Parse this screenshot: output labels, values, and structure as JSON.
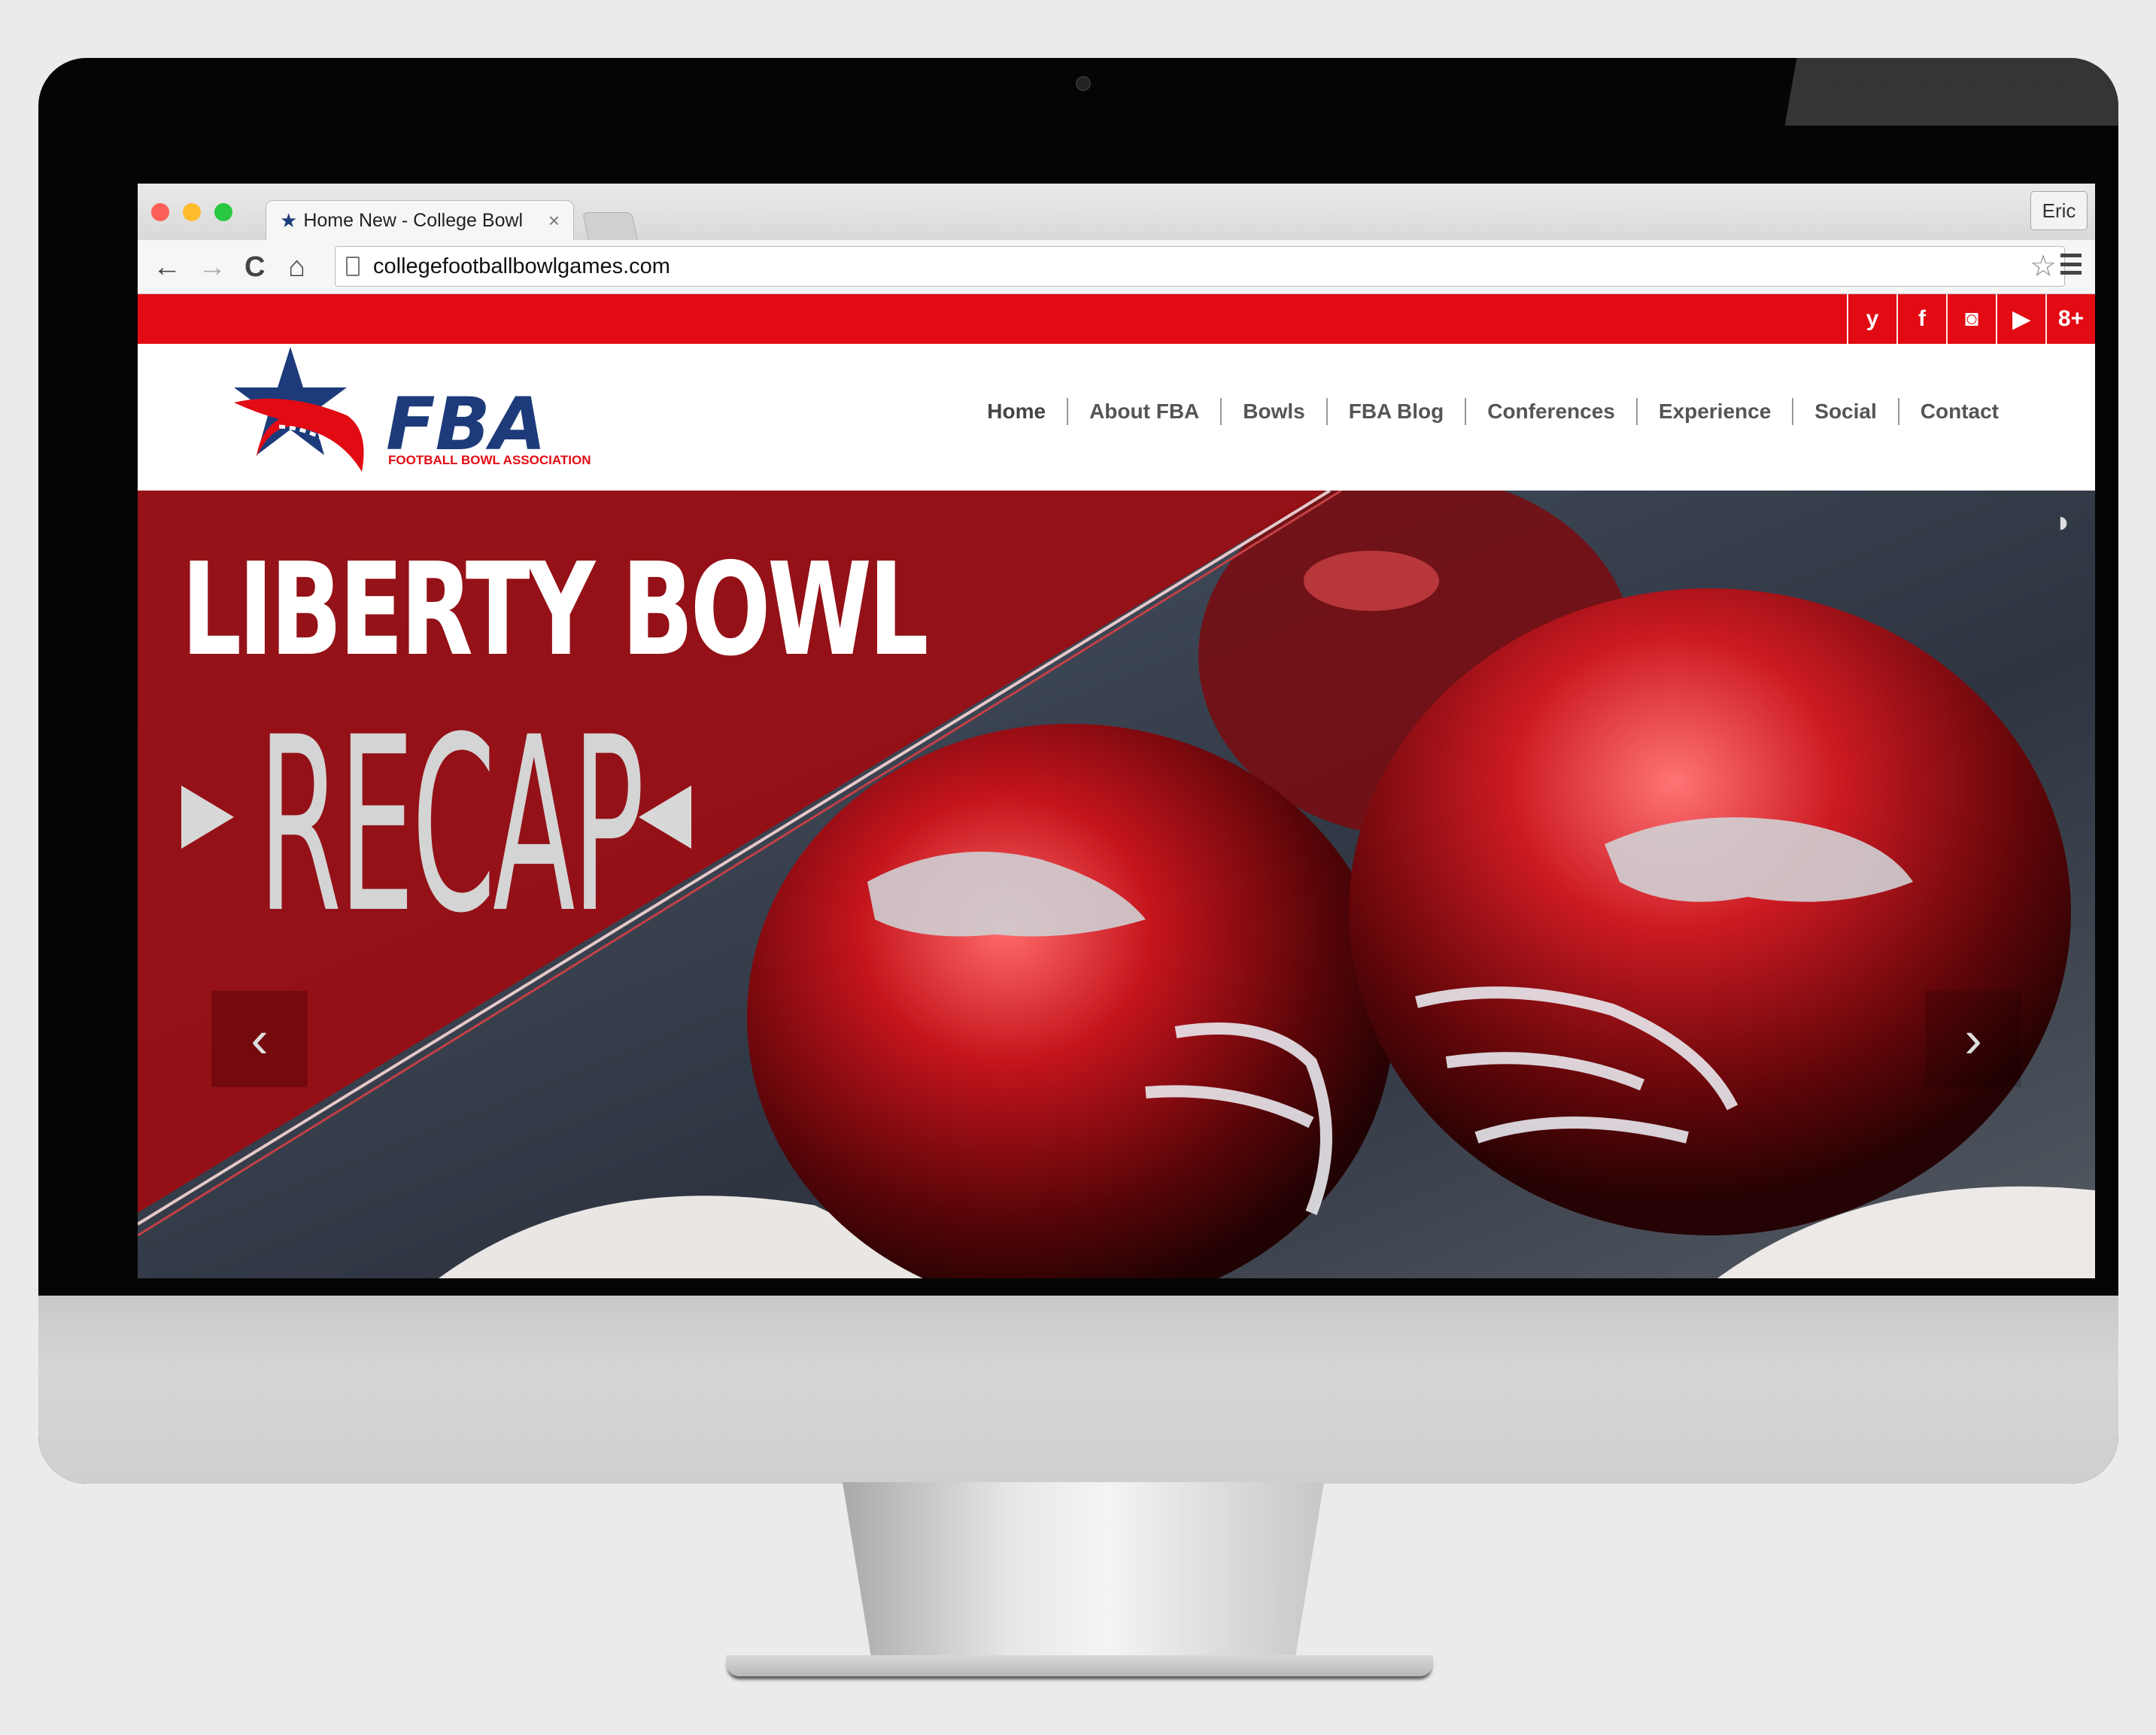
{
  "browser": {
    "tab_title": "Home New - College Bowl",
    "tab_close": "×",
    "profile_name": "Eric",
    "url": "collegefootballbowlgames.com",
    "back_icon": "←",
    "forward_icon": "→",
    "reload_icon": "C",
    "home_icon": "⌂",
    "bookmark_icon": "☆"
  },
  "social": [
    "y",
    "f",
    "◙",
    "▶",
    "8+"
  ],
  "social_names": [
    "twitter",
    "facebook",
    "instagram",
    "youtube",
    "google-plus"
  ],
  "logo": {
    "title": "FBA",
    "subtitle": "FOOTBALL BOWL ASSOCIATION"
  },
  "nav": [
    "Home",
    "About FBA",
    "Bowls",
    "FBA Blog",
    "Conferences",
    "Experience",
    "Social",
    "Contact"
  ],
  "hero": {
    "headline": "LIBERTY BOWL",
    "subheadline": "RECAP",
    "prev_icon": "‹",
    "next_icon": "›",
    "loader_icon": "◗"
  },
  "colors": {
    "brand_red": "#e20b13",
    "brand_navy": "#1d3b7a",
    "hero_red": "#9b0d12"
  }
}
